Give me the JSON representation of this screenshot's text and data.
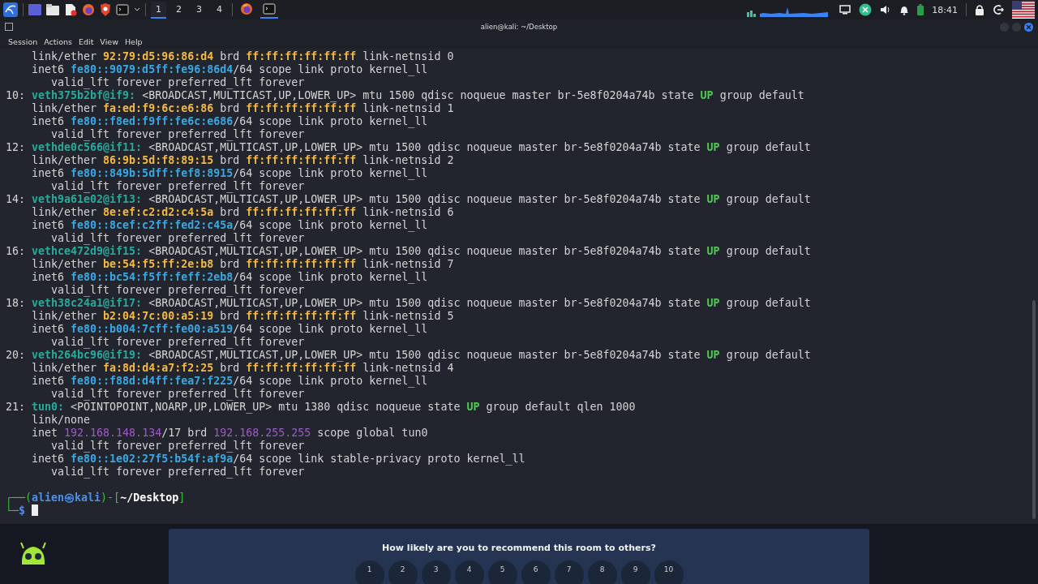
{
  "taskbar": {
    "workspaces": [
      {
        "label": "1",
        "selected": true
      },
      {
        "label": "2",
        "selected": false
      },
      {
        "label": "3",
        "selected": false
      },
      {
        "label": "4",
        "selected": false
      }
    ],
    "apps": [
      {
        "kind": "browser",
        "active": false
      },
      {
        "kind": "terminal",
        "active": true
      }
    ],
    "clock": "18:41"
  },
  "window": {
    "title": "alien@kali: ~/Desktop",
    "menu": [
      "Session",
      "Actions",
      "Edit",
      "View",
      "Help"
    ]
  },
  "terminal": {
    "lines": [
      {
        "segs": [
          {
            "t": "    link/ether ",
            "kind": "plain"
          },
          {
            "t": "92:79:d5:96:86:d4",
            "kind": "mac"
          },
          {
            "t": " brd ",
            "kind": "plain"
          },
          {
            "t": "ff:ff:ff:ff:ff:ff",
            "kind": "mac"
          },
          {
            "t": " link-netnsid 0",
            "kind": "plain"
          }
        ]
      },
      {
        "segs": [
          {
            "t": "    inet6 ",
            "kind": "plain"
          },
          {
            "t": "fe80::9079:d5ff:fe96:86d4",
            "kind": "ip6"
          },
          {
            "t": "/64 scope link proto kernel_ll",
            "kind": "plain"
          }
        ]
      },
      {
        "segs": [
          {
            "t": "       valid_lft forever preferred_lft forever",
            "kind": "plain"
          }
        ]
      },
      {
        "segs": [
          {
            "t": "10: ",
            "kind": "plain"
          },
          {
            "t": "veth375b2bf@if9:",
            "kind": "iface"
          },
          {
            "t": " <BROADCAST,MULTICAST,UP,LOWER_UP> mtu 1500 qdisc noqueue master br-5e8f0204a74b state ",
            "kind": "plain"
          },
          {
            "t": "UP",
            "kind": "up"
          },
          {
            "t": " group default",
            "kind": "plain"
          }
        ]
      },
      {
        "segs": [
          {
            "t": "    link/ether ",
            "kind": "plain"
          },
          {
            "t": "fa:ed:f9:6c:e6:86",
            "kind": "mac"
          },
          {
            "t": " brd ",
            "kind": "plain"
          },
          {
            "t": "ff:ff:ff:ff:ff:ff",
            "kind": "mac"
          },
          {
            "t": " link-netnsid 1",
            "kind": "plain"
          }
        ]
      },
      {
        "segs": [
          {
            "t": "    inet6 ",
            "kind": "plain"
          },
          {
            "t": "fe80::f8ed:f9ff:fe6c:e686",
            "kind": "ip6"
          },
          {
            "t": "/64 scope link proto kernel_ll",
            "kind": "plain"
          }
        ]
      },
      {
        "segs": [
          {
            "t": "       valid_lft forever preferred_lft forever",
            "kind": "plain"
          }
        ]
      },
      {
        "segs": [
          {
            "t": "12: ",
            "kind": "plain"
          },
          {
            "t": "vethde0c566@if11:",
            "kind": "iface"
          },
          {
            "t": " <BROADCAST,MULTICAST,UP,LOWER_UP> mtu 1500 qdisc noqueue master br-5e8f0204a74b state ",
            "kind": "plain"
          },
          {
            "t": "UP",
            "kind": "up"
          },
          {
            "t": " group default",
            "kind": "plain"
          }
        ]
      },
      {
        "segs": [
          {
            "t": "    link/ether ",
            "kind": "plain"
          },
          {
            "t": "86:9b:5d:f8:89:15",
            "kind": "mac"
          },
          {
            "t": " brd ",
            "kind": "plain"
          },
          {
            "t": "ff:ff:ff:ff:ff:ff",
            "kind": "mac"
          },
          {
            "t": " link-netnsid 2",
            "kind": "plain"
          }
        ]
      },
      {
        "segs": [
          {
            "t": "    inet6 ",
            "kind": "plain"
          },
          {
            "t": "fe80::849b:5dff:fef8:8915",
            "kind": "ip6"
          },
          {
            "t": "/64 scope link proto kernel_ll",
            "kind": "plain"
          }
        ]
      },
      {
        "segs": [
          {
            "t": "       valid_lft forever preferred_lft forever",
            "kind": "plain"
          }
        ]
      },
      {
        "segs": [
          {
            "t": "14: ",
            "kind": "plain"
          },
          {
            "t": "veth9a61e02@if13:",
            "kind": "iface"
          },
          {
            "t": " <BROADCAST,MULTICAST,UP,LOWER_UP> mtu 1500 qdisc noqueue master br-5e8f0204a74b state ",
            "kind": "plain"
          },
          {
            "t": "UP",
            "kind": "up"
          },
          {
            "t": " group default",
            "kind": "plain"
          }
        ]
      },
      {
        "segs": [
          {
            "t": "    link/ether ",
            "kind": "plain"
          },
          {
            "t": "8e:ef:c2:d2:c4:5a",
            "kind": "mac"
          },
          {
            "t": " brd ",
            "kind": "plain"
          },
          {
            "t": "ff:ff:ff:ff:ff:ff",
            "kind": "mac"
          },
          {
            "t": " link-netnsid 6",
            "kind": "plain"
          }
        ]
      },
      {
        "segs": [
          {
            "t": "    inet6 ",
            "kind": "plain"
          },
          {
            "t": "fe80::8cef:c2ff:fed2:c45a",
            "kind": "ip6"
          },
          {
            "t": "/64 scope link proto kernel_ll",
            "kind": "plain"
          }
        ]
      },
      {
        "segs": [
          {
            "t": "       valid_lft forever preferred_lft forever",
            "kind": "plain"
          }
        ]
      },
      {
        "segs": [
          {
            "t": "16: ",
            "kind": "plain"
          },
          {
            "t": "vethce472d9@if15:",
            "kind": "iface"
          },
          {
            "t": " <BROADCAST,MULTICAST,UP,LOWER_UP> mtu 1500 qdisc noqueue master br-5e8f0204a74b state ",
            "kind": "plain"
          },
          {
            "t": "UP",
            "kind": "up"
          },
          {
            "t": " group default",
            "kind": "plain"
          }
        ]
      },
      {
        "segs": [
          {
            "t": "    link/ether ",
            "kind": "plain"
          },
          {
            "t": "be:54:f5:ff:2e:b8",
            "kind": "mac"
          },
          {
            "t": " brd ",
            "kind": "plain"
          },
          {
            "t": "ff:ff:ff:ff:ff:ff",
            "kind": "mac"
          },
          {
            "t": " link-netnsid 7",
            "kind": "plain"
          }
        ]
      },
      {
        "segs": [
          {
            "t": "    inet6 ",
            "kind": "plain"
          },
          {
            "t": "fe80::bc54:f5ff:feff:2eb8",
            "kind": "ip6"
          },
          {
            "t": "/64 scope link proto kernel_ll",
            "kind": "plain"
          }
        ]
      },
      {
        "segs": [
          {
            "t": "       valid_lft forever preferred_lft forever",
            "kind": "plain"
          }
        ]
      },
      {
        "segs": [
          {
            "t": "18: ",
            "kind": "plain"
          },
          {
            "t": "veth38c24a1@if17:",
            "kind": "iface"
          },
          {
            "t": " <BROADCAST,MULTICAST,UP,LOWER_UP> mtu 1500 qdisc noqueue master br-5e8f0204a74b state ",
            "kind": "plain"
          },
          {
            "t": "UP",
            "kind": "up"
          },
          {
            "t": " group default",
            "kind": "plain"
          }
        ]
      },
      {
        "segs": [
          {
            "t": "    link/ether ",
            "kind": "plain"
          },
          {
            "t": "b2:04:7c:00:a5:19",
            "kind": "mac"
          },
          {
            "t": " brd ",
            "kind": "plain"
          },
          {
            "t": "ff:ff:ff:ff:ff:ff",
            "kind": "mac"
          },
          {
            "t": " link-netnsid 5",
            "kind": "plain"
          }
        ]
      },
      {
        "segs": [
          {
            "t": "    inet6 ",
            "kind": "plain"
          },
          {
            "t": "fe80::b004:7cff:fe00:a519",
            "kind": "ip6"
          },
          {
            "t": "/64 scope link proto kernel_ll",
            "kind": "plain"
          }
        ]
      },
      {
        "segs": [
          {
            "t": "       valid_lft forever preferred_lft forever",
            "kind": "plain"
          }
        ]
      },
      {
        "segs": [
          {
            "t": "20: ",
            "kind": "plain"
          },
          {
            "t": "veth264bc96@if19:",
            "kind": "iface"
          },
          {
            "t": " <BROADCAST,MULTICAST,UP,LOWER_UP> mtu 1500 qdisc noqueue master br-5e8f0204a74b state ",
            "kind": "plain"
          },
          {
            "t": "UP",
            "kind": "up"
          },
          {
            "t": " group default",
            "kind": "plain"
          }
        ]
      },
      {
        "segs": [
          {
            "t": "    link/ether ",
            "kind": "plain"
          },
          {
            "t": "fa:8d:d4:a7:f2:25",
            "kind": "mac"
          },
          {
            "t": " brd ",
            "kind": "plain"
          },
          {
            "t": "ff:ff:ff:ff:ff:ff",
            "kind": "mac"
          },
          {
            "t": " link-netnsid 4",
            "kind": "plain"
          }
        ]
      },
      {
        "segs": [
          {
            "t": "    inet6 ",
            "kind": "plain"
          },
          {
            "t": "fe80::f88d:d4ff:fea7:f225",
            "kind": "ip6"
          },
          {
            "t": "/64 scope link proto kernel_ll",
            "kind": "plain"
          }
        ]
      },
      {
        "segs": [
          {
            "t": "       valid_lft forever preferred_lft forever",
            "kind": "plain"
          }
        ]
      },
      {
        "segs": [
          {
            "t": "21: ",
            "kind": "plain"
          },
          {
            "t": "tun0:",
            "kind": "iface"
          },
          {
            "t": " <POINTOPOINT,NOARP,UP,LOWER_UP> mtu 1380 qdisc noqueue state ",
            "kind": "plain"
          },
          {
            "t": "UP",
            "kind": "up"
          },
          {
            "t": " group default qlen 1000",
            "kind": "plain"
          }
        ]
      },
      {
        "segs": [
          {
            "t": "    link/none",
            "kind": "plain"
          }
        ]
      },
      {
        "segs": [
          {
            "t": "    inet ",
            "kind": "plain"
          },
          {
            "t": "192.168.148.134",
            "kind": "ip4"
          },
          {
            "t": "/17 brd ",
            "kind": "plain"
          },
          {
            "t": "192.168.255.255",
            "kind": "ip4"
          },
          {
            "t": " scope global tun0",
            "kind": "plain"
          }
        ]
      },
      {
        "segs": [
          {
            "t": "       valid_lft forever preferred_lft forever",
            "kind": "plain"
          }
        ]
      },
      {
        "segs": [
          {
            "t": "    inet6 ",
            "kind": "plain"
          },
          {
            "t": "fe80::1e02:27f5:b54f:af9a",
            "kind": "ip6"
          },
          {
            "t": "/64 scope link stable-privacy proto kernel_ll",
            "kind": "plain"
          }
        ]
      },
      {
        "segs": [
          {
            "t": "       valid_lft forever preferred_lft forever",
            "kind": "plain"
          }
        ]
      },
      {
        "spaced": true,
        "segs": [
          {
            "t": "┌──(",
            "kind": "frame"
          },
          {
            "t": "alien㉿kali",
            "kind": "host"
          },
          {
            "t": ")-[",
            "kind": "frame"
          },
          {
            "t": "~/Desktop",
            "kind": "path"
          },
          {
            "t": "]",
            "kind": "frame"
          }
        ]
      },
      {
        "cursor": true,
        "segs": [
          {
            "t": "└─",
            "kind": "frame"
          },
          {
            "t": "$",
            "kind": "host"
          }
        ]
      }
    ]
  },
  "feedback": {
    "question": "How likely are you to recommend this room to others?",
    "ratings": [
      "1",
      "2",
      "3",
      "4",
      "5",
      "6",
      "7",
      "8",
      "9",
      "10"
    ]
  }
}
